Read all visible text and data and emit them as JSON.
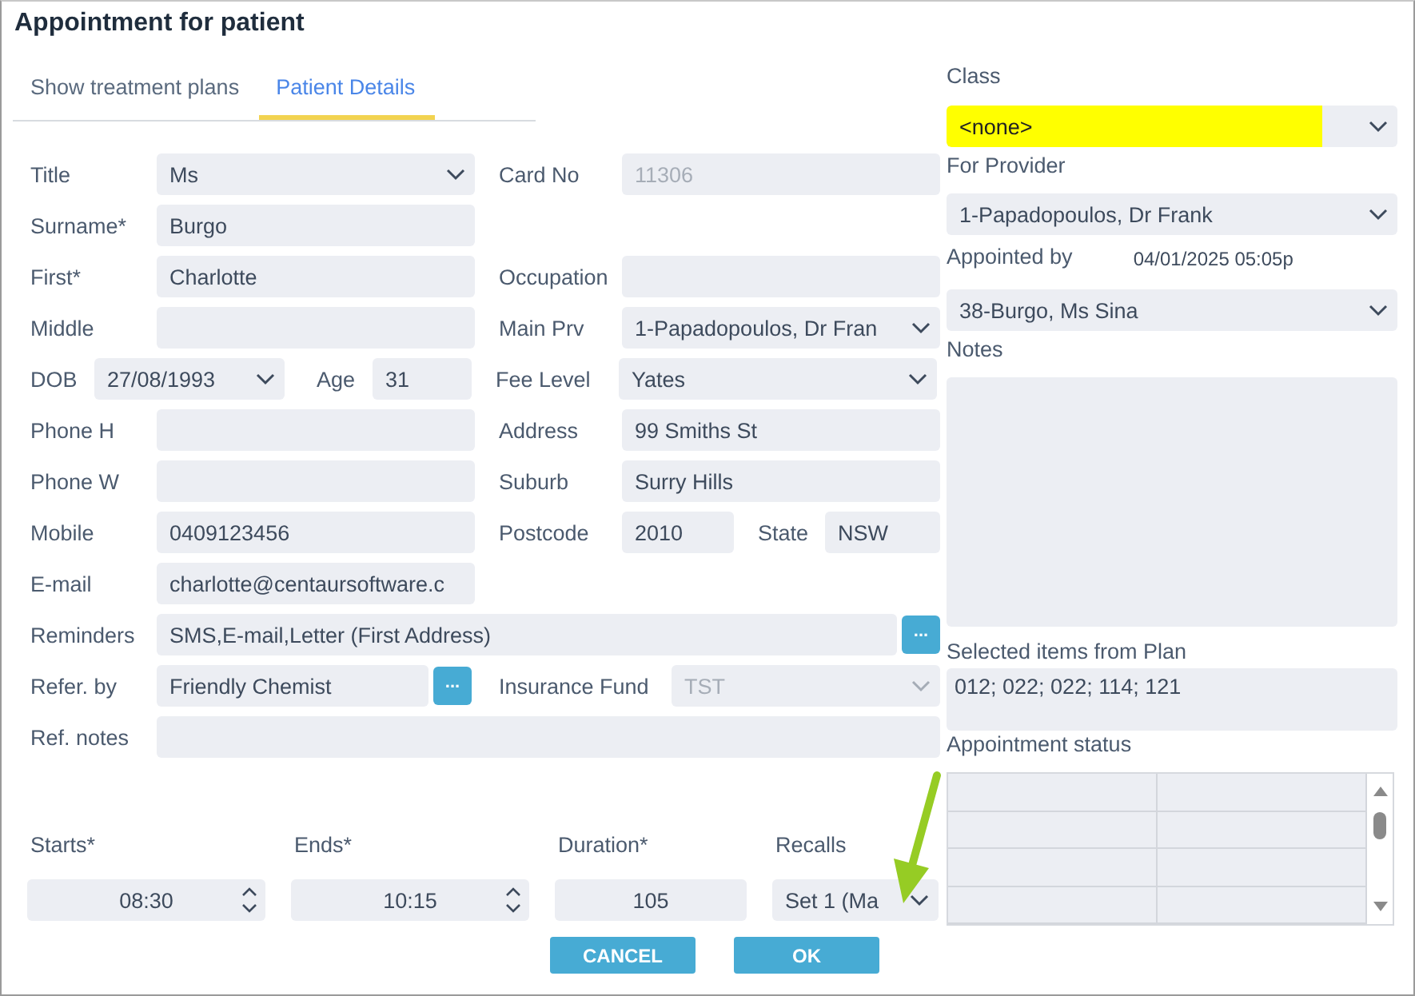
{
  "window": {
    "title": "Appointment for patient"
  },
  "tabs": [
    {
      "label": "Show treatment plans",
      "selected": false
    },
    {
      "label": "Patient Details",
      "selected": true
    }
  ],
  "form": {
    "rows": [
      {
        "kind": "pair",
        "fields": [
          {
            "label": "Title",
            "kind": "select",
            "value": "Ms"
          },
          {
            "label": "Card No",
            "kind": "input",
            "value": "11306",
            "disabled": true
          }
        ]
      },
      {
        "kind": "pair",
        "fields": [
          {
            "label": "Surname*",
            "kind": "input",
            "value": "Burgo"
          }
        ]
      },
      {
        "kind": "pair",
        "fields": [
          {
            "label": "First*",
            "kind": "input",
            "value": "Charlotte"
          },
          {
            "label": "Occupation",
            "kind": "input"
          }
        ]
      },
      {
        "kind": "pair",
        "fields": [
          {
            "label": "Middle",
            "kind": "input"
          },
          {
            "label": "Main Prv",
            "kind": "select",
            "value": "1-Papadopoulos, Dr Fran"
          }
        ]
      },
      {
        "kind": "dob",
        "fields": [
          {
            "label": "DOB",
            "kind": "select",
            "value": "27/08/1993"
          },
          {
            "label": "Age",
            "kind": "input",
            "value": "31"
          },
          {
            "label": "Fee Level",
            "kind": "select",
            "value": "Yates"
          }
        ]
      },
      {
        "kind": "pair",
        "fields": [
          {
            "label": "Phone H",
            "kind": "input"
          },
          {
            "label": "Address",
            "kind": "input",
            "value": "99 Smiths St"
          }
        ]
      },
      {
        "kind": "pair",
        "fields": [
          {
            "label": "Phone W",
            "kind": "input"
          },
          {
            "label": "Suburb",
            "kind": "input",
            "value": "Surry Hills"
          }
        ]
      },
      {
        "kind": "postcode",
        "fields": [
          {
            "label": "Mobile",
            "kind": "input",
            "value": "0409123456"
          },
          {
            "label": "Postcode",
            "kind": "input",
            "value": "2010"
          },
          {
            "label": "State",
            "kind": "input",
            "value": "NSW"
          }
        ]
      },
      {
        "kind": "pair",
        "fields": [
          {
            "label": "E-mail",
            "kind": "input",
            "value": "charlotte@centaursoftware.c"
          }
        ]
      },
      {
        "kind": "full",
        "fields": [
          {
            "label": "Reminders",
            "kind": "picker",
            "value": "SMS,E-mail,Letter (First Address)",
            "button": "..."
          }
        ]
      },
      {
        "kind": "refer",
        "fields": [
          {
            "label": "Refer. by",
            "kind": "picker",
            "value": "Friendly Chemist",
            "button": "..."
          },
          {
            "label": "Insurance Fund",
            "kind": "select",
            "value": "TST",
            "disabled": true
          }
        ]
      },
      {
        "kind": "full",
        "fields": [
          {
            "label": "Ref. notes",
            "kind": "input"
          }
        ]
      }
    ]
  },
  "timing": [
    {
      "label": "Starts*",
      "kind": "spin",
      "value": "08:30"
    },
    {
      "label": "Ends*",
      "kind": "spin",
      "value": "10:15"
    },
    {
      "label": "Duration*",
      "kind": "input",
      "value": "105"
    },
    {
      "label": "Recalls",
      "kind": "select",
      "value": "Set 1 (Ma"
    }
  ],
  "buttons": [
    {
      "label": "CANCEL"
    },
    {
      "label": "OK"
    }
  ],
  "side": {
    "class": {
      "label": "Class",
      "value": "<none>",
      "highlighted": true
    },
    "provider": {
      "label": "For Provider",
      "value": "1-Papadopoulos, Dr Frank"
    },
    "appointed_by": {
      "label": "Appointed by",
      "date": "04/01/2025 05:05p",
      "value": "38-Burgo, Ms Sina"
    },
    "notes": {
      "label": "Notes"
    },
    "selected_items": {
      "label": "Selected items from Plan",
      "value": "012; 022; 022; 114; 121"
    },
    "status": {
      "label": "Appointment status"
    }
  }
}
